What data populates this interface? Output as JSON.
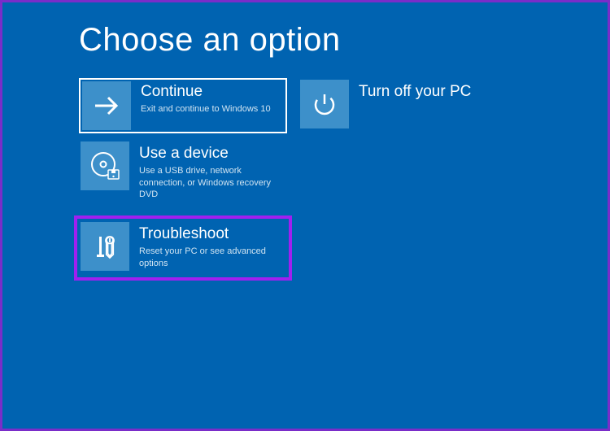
{
  "page": {
    "title": "Choose an option"
  },
  "options": {
    "continue": {
      "title": "Continue",
      "desc": "Exit and continue to Windows 10"
    },
    "turnoff": {
      "title": "Turn off your PC",
      "desc": ""
    },
    "usedevice": {
      "title": "Use a device",
      "desc": "Use a USB drive, network connection, or Windows recovery DVD"
    },
    "troubleshoot": {
      "title": "Troubleshoot",
      "desc": "Reset your PC or see advanced options"
    }
  },
  "colors": {
    "background": "#0063b1",
    "tile_icon_bg": "#3d90ca",
    "highlight_border": "#a020f0",
    "outer_border": "#7a2dc9"
  }
}
